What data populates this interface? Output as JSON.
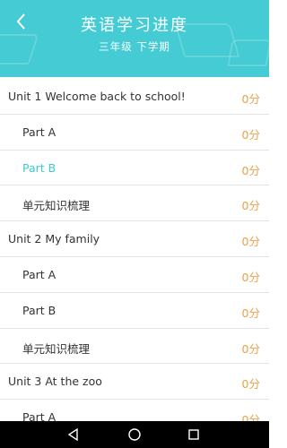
{
  "header": {
    "title": "英语学习进度",
    "subtitle": "三年级 下学期"
  },
  "rows": [
    {
      "label": "Unit 1 Welcome back to school!",
      "score": "0分"
    },
    {
      "label": "Part A",
      "score": "0分"
    },
    {
      "label": "Part B",
      "score": "0分"
    },
    {
      "label": "单元知识梳理",
      "score": "0分"
    },
    {
      "label": "Unit 2 My family",
      "score": "0分"
    },
    {
      "label": "Part A",
      "score": "0分"
    },
    {
      "label": "Part B",
      "score": "0分"
    },
    {
      "label": "单元知识梳理",
      "score": "0分"
    },
    {
      "label": "Unit 3 At the zoo",
      "score": "0分"
    },
    {
      "label": "Part A",
      "score": "0分"
    }
  ],
  "colors": {
    "header_bg": "#44cbd3",
    "active_text": "#3fc8cf",
    "score_text": "#e8a24a"
  },
  "icons": {
    "back": "chevron-left-icon",
    "nav_back": "triangle-back-icon",
    "nav_home": "circle-home-icon",
    "nav_recent": "square-recent-icon"
  }
}
